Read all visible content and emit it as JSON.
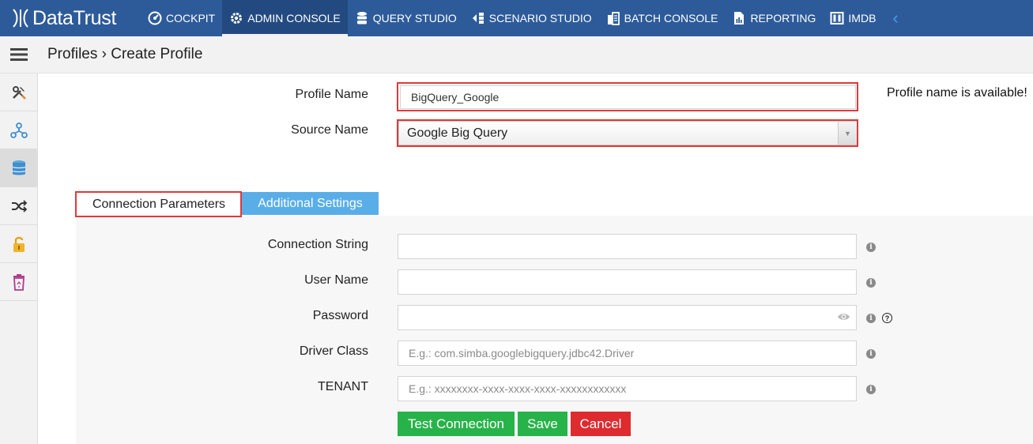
{
  "app": {
    "name": "DataTrust"
  },
  "nav": {
    "items": [
      {
        "label": "COCKPIT",
        "icon": "gauge-icon"
      },
      {
        "label": "ADMIN CONSOLE",
        "icon": "gear-icon",
        "active": true
      },
      {
        "label": "QUERY STUDIO",
        "icon": "database-icon"
      },
      {
        "label": "SCENARIO STUDIO",
        "icon": "workflow-icon"
      },
      {
        "label": "BATCH CONSOLE",
        "icon": "batch-icon"
      },
      {
        "label": "REPORTING",
        "icon": "report-icon"
      },
      {
        "label": "IMDB",
        "icon": "columns-icon"
      }
    ],
    "more_icon": "chevron-left-icon"
  },
  "header": {
    "breadcrumb": "Profiles › Create Profile"
  },
  "sidebar": {
    "items": [
      {
        "icon": "tools-icon"
      },
      {
        "icon": "network-icon"
      },
      {
        "icon": "database-icon",
        "active": true
      },
      {
        "icon": "shuffle-icon"
      },
      {
        "icon": "lock-icon"
      },
      {
        "icon": "trash-icon"
      }
    ]
  },
  "form": {
    "profile_name": {
      "label": "Profile Name",
      "value": "BigQuery_Google",
      "status": "Profile name is available!"
    },
    "source_name": {
      "label": "Source Name",
      "value": "Google Big Query"
    }
  },
  "tabs": {
    "connection": "Connection Parameters",
    "additional": "Additional Settings"
  },
  "connection": {
    "connection_string": {
      "label": "Connection String",
      "value": "",
      "placeholder": ""
    },
    "user_name": {
      "label": "User Name",
      "value": "",
      "placeholder": ""
    },
    "password": {
      "label": "Password",
      "value": "",
      "placeholder": ""
    },
    "driver_class": {
      "label": "Driver Class",
      "value": "",
      "placeholder": "E.g.: com.simba.googlebigquery.jdbc42.Driver"
    },
    "tenant": {
      "label": "TENANT",
      "value": "",
      "placeholder": "E.g.: xxxxxxxx-xxxx-xxxx-xxxx-xxxxxxxxxxxx"
    }
  },
  "actions": {
    "test": "Test Connection",
    "save": "Save",
    "cancel": "Cancel"
  },
  "colors": {
    "nav_bg": "#2d5b9a",
    "tab_active_bg": "#5aaee8",
    "button_green": "#27b349",
    "button_red": "#dd2b30",
    "highlight_red": "#e0393b"
  }
}
